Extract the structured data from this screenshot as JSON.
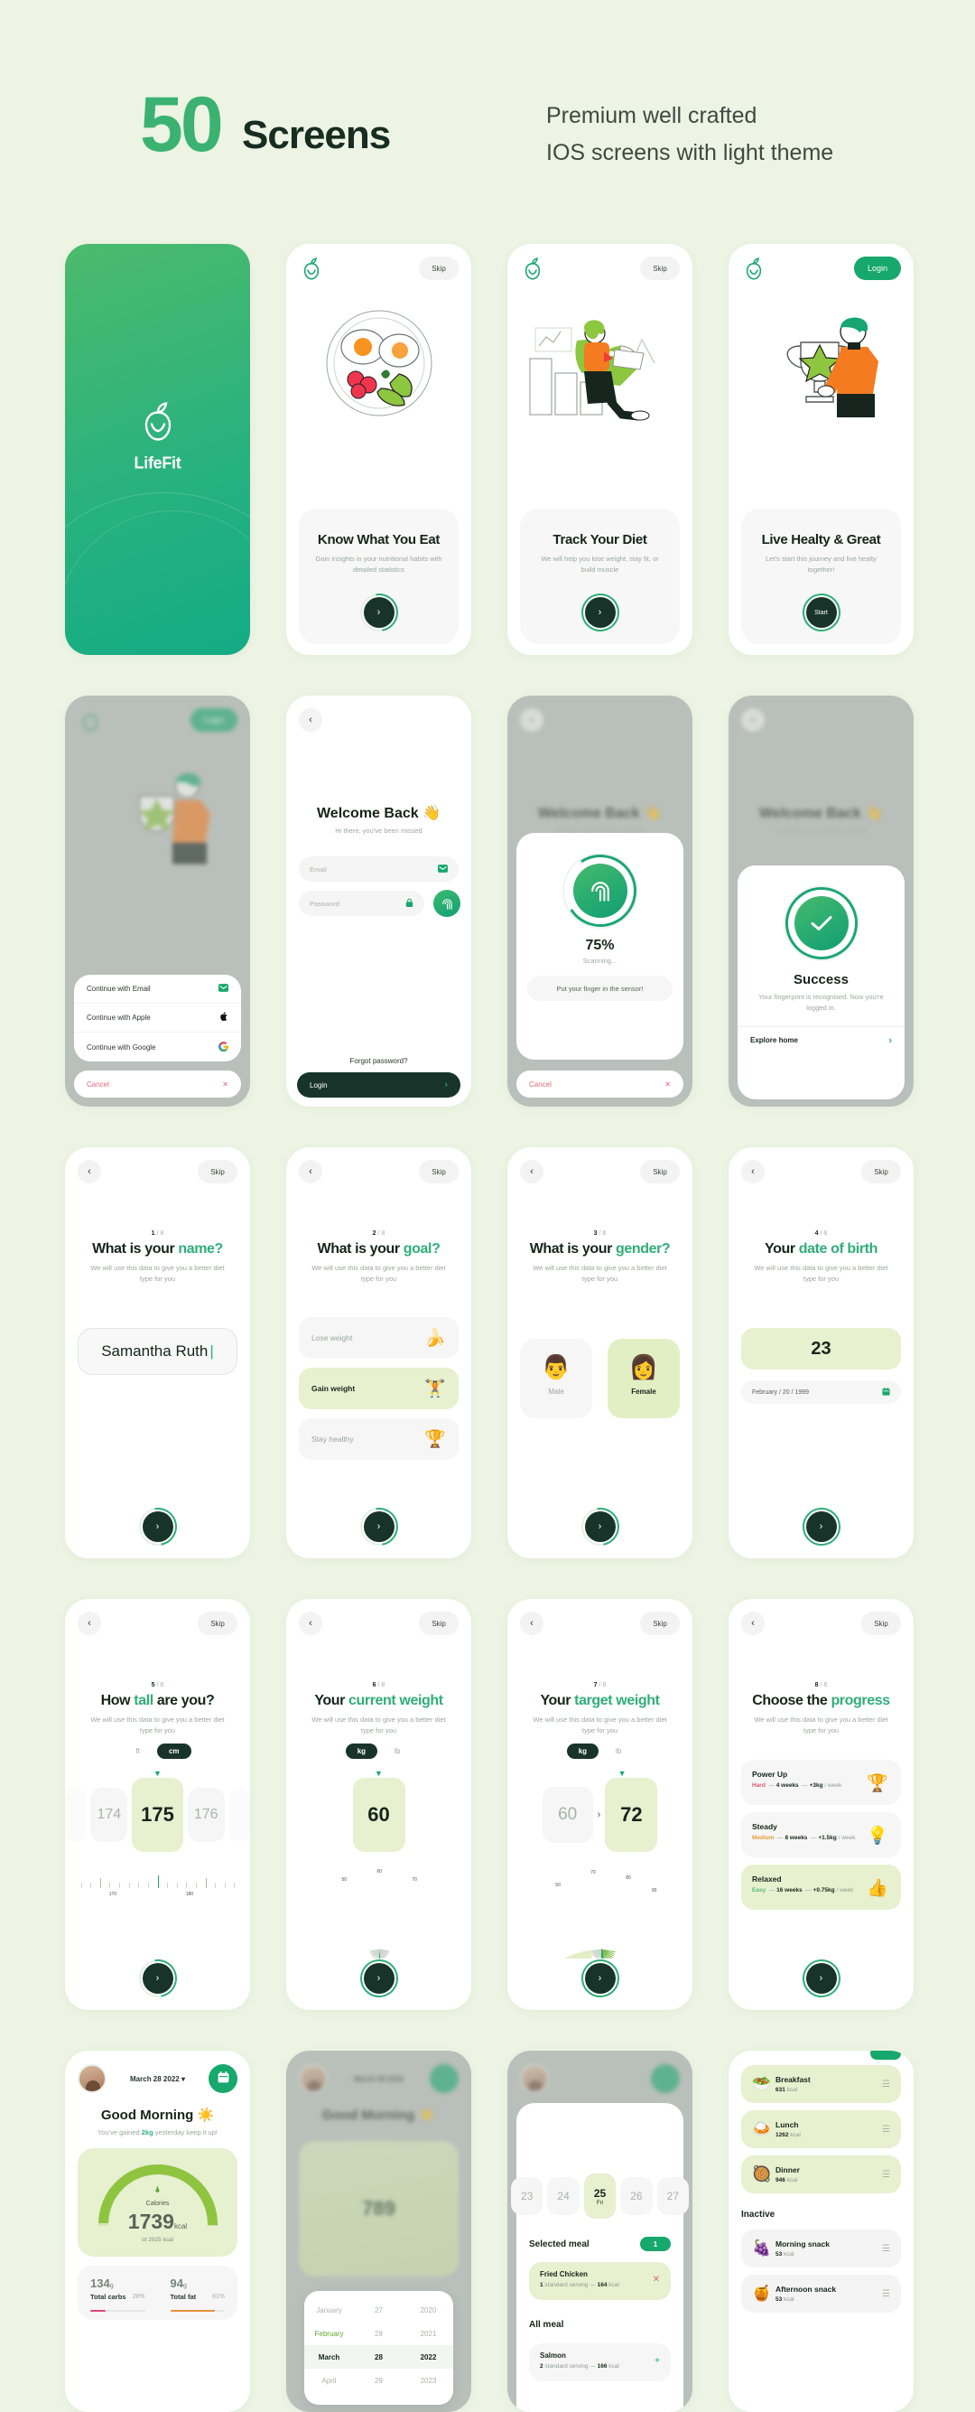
{
  "header": {
    "count": "50",
    "count_label": "Screens",
    "tagline_line1": "Premium well crafted",
    "tagline_line2": "IOS screens with light theme"
  },
  "common": {
    "skip": "Skip",
    "back_icon": "‹",
    "arrow_icon": "›",
    "apple_logo_icon": "apple-leaf-logo",
    "quiz_subtitle": "We will use this data to give you a better diet type for you",
    "accent_green": "#2fae79",
    "brand_green": "#16a86c",
    "dark_green": "#18342a",
    "lime_selected": "#e7f0cf",
    "page_bg": "#edf4e3"
  },
  "screens": [
    {
      "id": "splash",
      "app_name": "LifeFit"
    },
    {
      "id": "onboarding-1",
      "title": "Know What You Eat",
      "subtitle": "Gain insights in your nutritional habits with detailed statistics",
      "skip": "Skip",
      "cta": "›"
    },
    {
      "id": "onboarding-2",
      "title": "Track Your Diet",
      "subtitle": "We will help you lose weight, stay fit, or build muscle",
      "skip": "Skip",
      "cta": "›"
    },
    {
      "id": "onboarding-3",
      "title": "Live Healty & Great",
      "subtitle": "Let's start this journey and live healty together!",
      "login": "Login",
      "cta": "Start"
    },
    {
      "id": "auth-sheet",
      "login": "Login",
      "options": [
        {
          "label": "Continue with Email",
          "icon": "envelope-icon"
        },
        {
          "label": "Continue with Apple",
          "icon": "apple-icon"
        },
        {
          "label": "Continue with Google",
          "icon": "google-icon"
        }
      ],
      "cancel": "Cancel",
      "cancel_icon": "✕"
    },
    {
      "id": "login",
      "title": "Welcome Back 👋",
      "subtitle": "Hi there, you've been missed",
      "email_placeholder": "Email",
      "password_placeholder": "Password",
      "forgot": "Forgot password?",
      "login_button": "Login"
    },
    {
      "id": "fingerprint-scanning",
      "percent": "75%",
      "status": "Scanning...",
      "hint": "Put your finger in the sensor!",
      "cancel": "Cancel",
      "cancel_icon": "✕",
      "bg_title": "Welcome Back 👋",
      "bg_subtitle": "Hi there, you've been missed"
    },
    {
      "id": "fingerprint-success",
      "title": "Success",
      "body": "Your fingerprint is recognised. Now you're logged in.",
      "link": "Explore home",
      "bg_title": "Welcome Back 👋",
      "bg_subtitle": "Hi there, you've been missed"
    },
    {
      "id": "quiz-name",
      "step": "1",
      "step_total": "/ 8",
      "title_plain": "What is your ",
      "title_accent": "name?",
      "value": "Samantha Ruth"
    },
    {
      "id": "quiz-goal",
      "step": "2",
      "step_total": "/ 8",
      "title_plain": "What is your ",
      "title_accent": "goal?",
      "options": [
        {
          "label": "Lose weight",
          "icon": "🍌",
          "selected": false
        },
        {
          "label": "Gain weight",
          "icon": "🏋",
          "selected": true
        },
        {
          "label": "Stay healthy",
          "icon": "🏆",
          "selected": false
        }
      ]
    },
    {
      "id": "quiz-gender",
      "step": "3",
      "step_total": "/ 8",
      "title_plain": "What is your ",
      "title_accent": "gender?",
      "options": [
        {
          "label": "Male",
          "icon": "👨",
          "selected": false
        },
        {
          "label": "Female",
          "icon": "👩",
          "selected": true
        }
      ]
    },
    {
      "id": "quiz-dob",
      "step": "4",
      "step_total": "/ 8",
      "title_plain": "Your ",
      "title_accent": "date of birth",
      "age": "23",
      "date": "February  /  20  /  1999",
      "calendar_icon": "calendar-icon"
    },
    {
      "id": "quiz-height",
      "step": "5",
      "step_total": "/ 8",
      "title_plain": "How ",
      "title_accent": "tall",
      "title_tail": " are you?",
      "units": [
        "ft",
        "cm"
      ],
      "unit_selected": "cm",
      "prev": "174",
      "value": "175",
      "next": "176",
      "ruler_labels": [
        "170",
        "180"
      ]
    },
    {
      "id": "quiz-current-weight",
      "step": "6",
      "step_total": "/ 8",
      "title_plain": "Your ",
      "title_accent": "current weight",
      "units": [
        "kg",
        "lb"
      ],
      "unit_selected": "kg",
      "value": "60",
      "dial_labels": [
        "50",
        "60",
        "70"
      ]
    },
    {
      "id": "quiz-target-weight",
      "step": "7",
      "step_total": "/ 8",
      "title_plain": "Your ",
      "title_accent": "target weight",
      "units": [
        "kg",
        "lb"
      ],
      "unit_selected": "kg",
      "from": "60",
      "to": "72",
      "arrow": "›",
      "dial_labels": [
        "50",
        "70",
        "80",
        "90"
      ]
    },
    {
      "id": "quiz-progress",
      "step": "8",
      "step_total": "/ 8",
      "title_plain": "Choose the ",
      "title_accent": "progress",
      "options": [
        {
          "name": "Power Up",
          "level": "Hard",
          "level_color": "#e5556d",
          "weeks": "4 weeks",
          "rate": "+3kg",
          "per": "/ week",
          "icon": "🏆",
          "selected": false
        },
        {
          "name": "Steady",
          "level": "Medium",
          "level_color": "#e89a3c",
          "weeks": "8 weeks",
          "rate": "+1.5kg",
          "per": "/ week",
          "icon": "💡",
          "selected": false
        },
        {
          "name": "Relaxed",
          "level": "Easy",
          "level_color": "#5bb878",
          "weeks": "16 weeks",
          "rate": "+0.75kg",
          "per": "/ week",
          "icon": "👍",
          "selected": true
        }
      ]
    },
    {
      "id": "home-dashboard",
      "date": "March 28 2022",
      "date_caret": "▾",
      "greeting": "Good Morning ☀️",
      "greeting_sub_pre": "You've gained ",
      "greeting_sub_bold": "2kg",
      "greeting_sub_post": " yesterday keep it up!",
      "calories_label": "Calories",
      "calories_value": "1739",
      "calories_unit": "kcal",
      "calories_of": "of 2925 kcal",
      "macros": [
        {
          "value": "134",
          "unit": "g",
          "name": "Total carbs",
          "percent": "28%",
          "color": "#e0447a",
          "fill": 28
        },
        {
          "value": "94",
          "unit": "g",
          "name": "Total fat",
          "percent": "81%",
          "color": "#e8903c",
          "fill": 81
        }
      ]
    },
    {
      "id": "home-calendar",
      "greeting": "Good Morning ☀️",
      "date": "March 28 2022",
      "gauge_value": "789",
      "calendar": {
        "months": [
          "January",
          "February",
          "March",
          "April"
        ],
        "days": [
          "27",
          "28",
          "28",
          "29"
        ],
        "years": [
          "2020",
          "2021",
          "2022",
          "2023"
        ],
        "selected_month": "March",
        "selected_day": "28",
        "selected_year": "2022"
      }
    },
    {
      "id": "meal-picker",
      "days": [
        {
          "num": "23",
          "dow": "",
          "selected": false
        },
        {
          "num": "24",
          "dow": "",
          "selected": false
        },
        {
          "num": "25",
          "dow": "Fri",
          "selected": true
        },
        {
          "num": "26",
          "dow": "",
          "selected": false
        },
        {
          "num": "27",
          "dow": "",
          "selected": false
        }
      ],
      "selected_meal_title": "Selected meal",
      "selected_count": "1",
      "selected_items": [
        {
          "name": "Fried Chicken",
          "serving_num": "1",
          "serving": " standard serving",
          "sep": "  —  ",
          "kcal": "164",
          "kcal_unit": " kcal",
          "action": "✕"
        }
      ],
      "all_meal_title": "All meal",
      "all_items": [
        {
          "name": "Salmon",
          "serving_num": "2",
          "serving": " standard serving",
          "sep": "  —  ",
          "kcal": "166",
          "kcal_unit": " kcal",
          "action": "+"
        }
      ]
    },
    {
      "id": "meal-list",
      "active": [
        {
          "name": "Breakfast",
          "kcal": "631",
          "kcal_unit": " kcal",
          "icon": "🥗"
        },
        {
          "name": "Lunch",
          "kcal": "1262",
          "kcal_unit": " kcal",
          "icon": "🍛"
        },
        {
          "name": "Dinner",
          "kcal": "946",
          "kcal_unit": " kcal",
          "icon": "🥘"
        }
      ],
      "inactive_label": "Inactive",
      "inactive": [
        {
          "name": "Morning snack",
          "kcal": "53",
          "kcal_unit": " kcal",
          "icon": "🍇"
        },
        {
          "name": "Afternoon snack",
          "kcal": "53",
          "kcal_unit": " kcal",
          "icon": "🍯"
        }
      ]
    }
  ]
}
